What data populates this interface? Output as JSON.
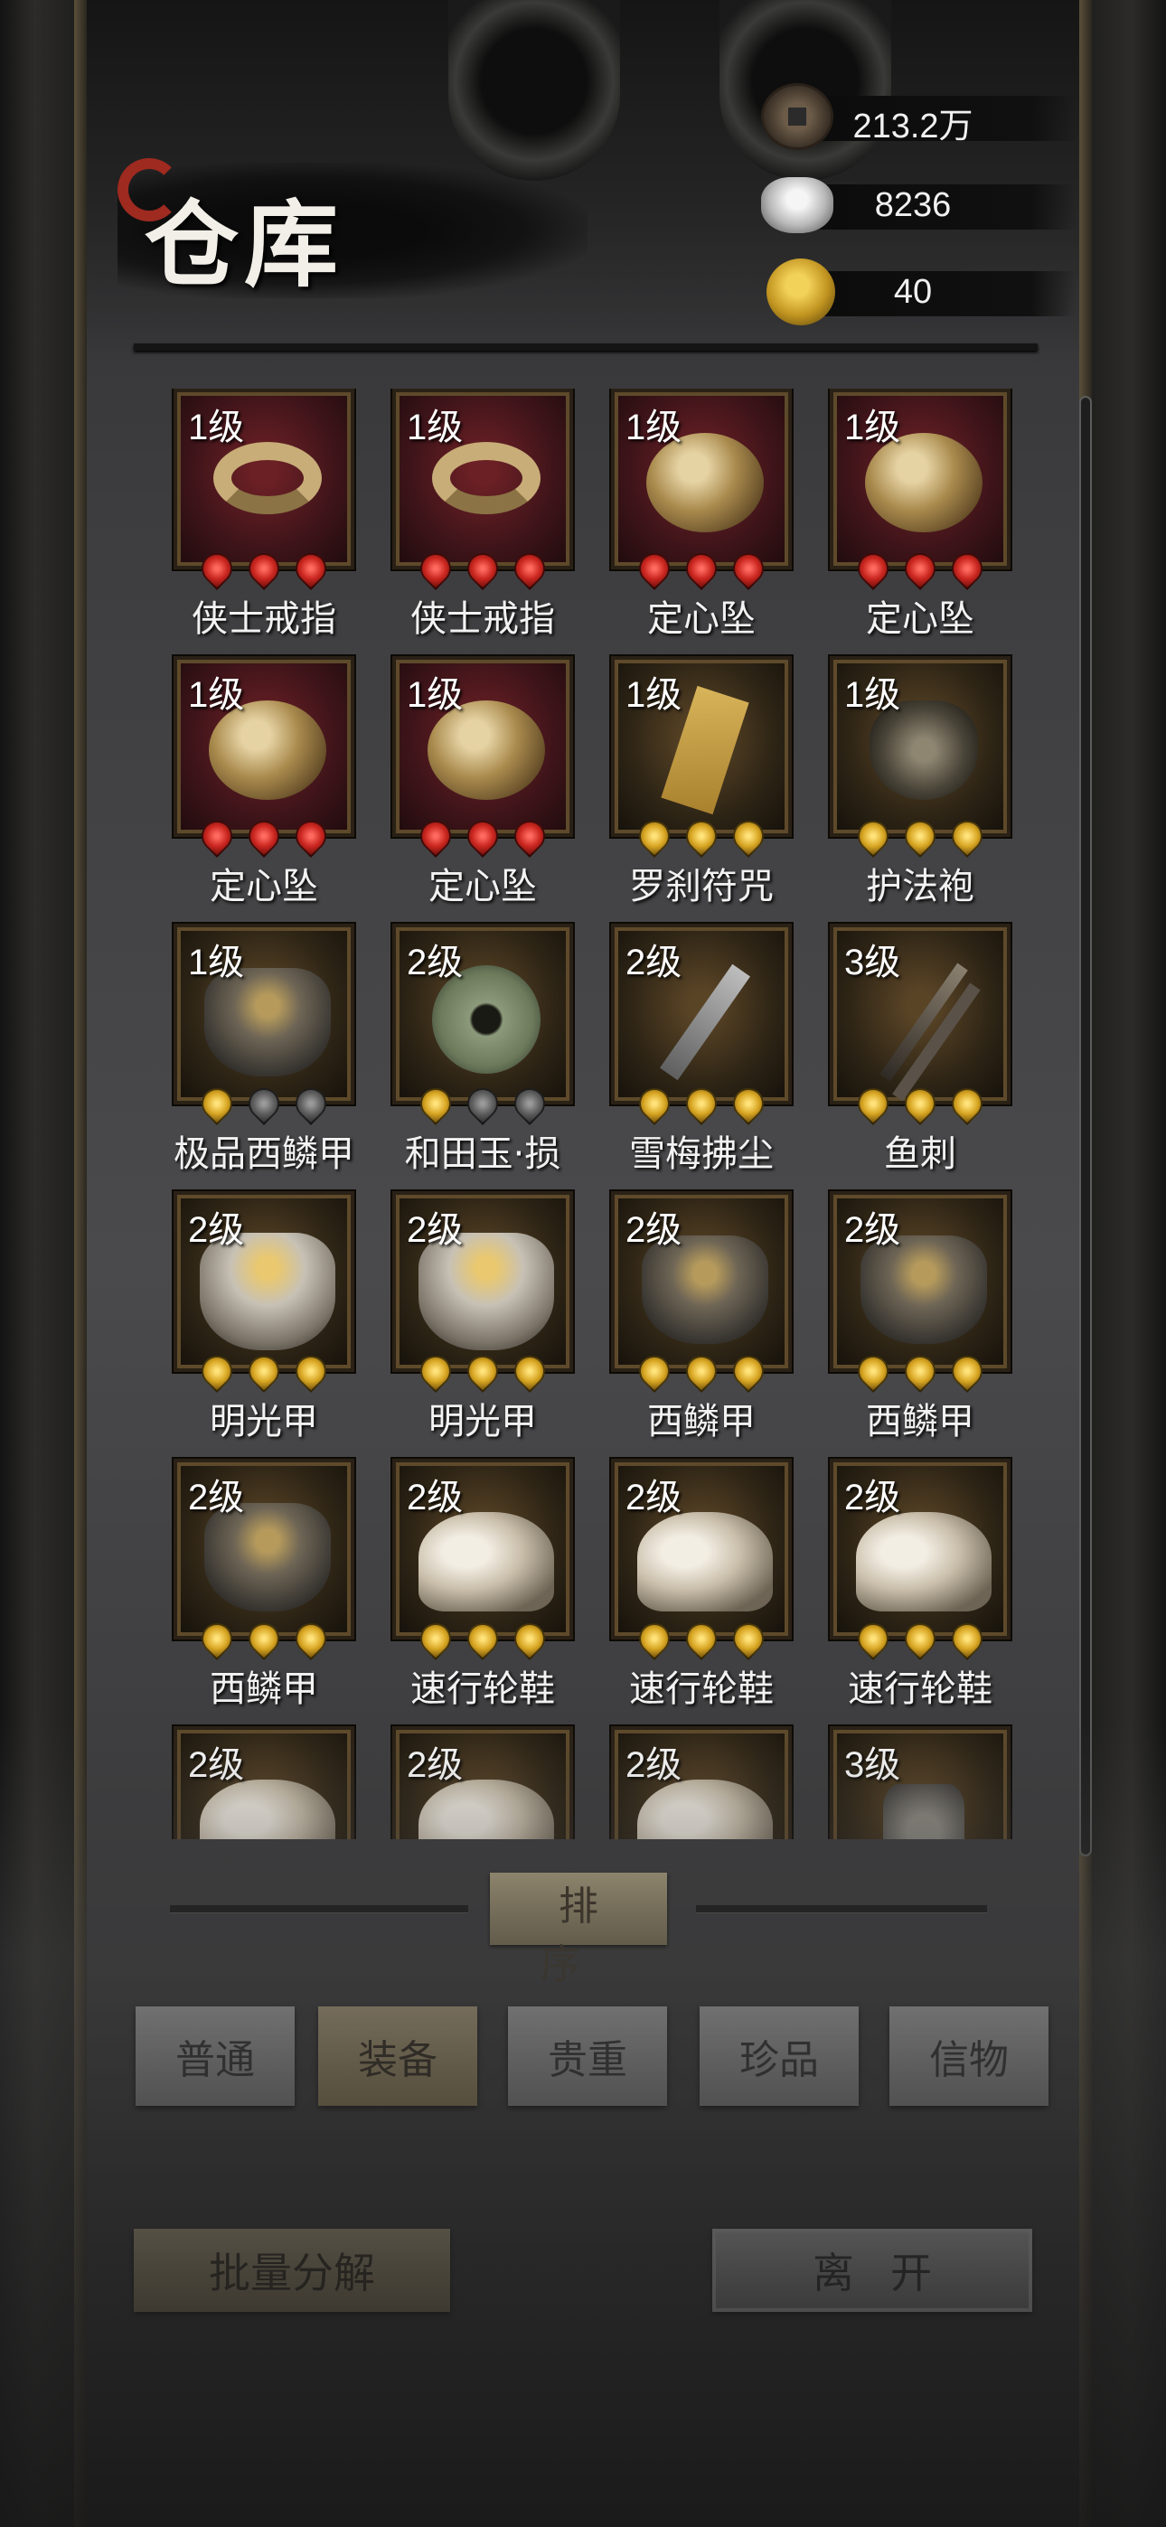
{
  "header": {
    "title": "仓库"
  },
  "currency": [
    {
      "icon": "copper-coin-icon",
      "value": "213.2万"
    },
    {
      "icon": "silver-ingot-icon",
      "value": "8236"
    },
    {
      "icon": "gold-coin-icon",
      "value": "40"
    }
  ],
  "items": [
    {
      "level": "1级",
      "name": "侠士戒指",
      "frame": "red",
      "icon": "ring-icon",
      "stars": [
        "r",
        "r",
        "r"
      ]
    },
    {
      "level": "1级",
      "name": "侠士戒指",
      "frame": "red",
      "icon": "ring-icon",
      "stars": [
        "r",
        "r",
        "r"
      ]
    },
    {
      "level": "1级",
      "name": "定心坠",
      "frame": "red",
      "icon": "pendant-icon",
      "stars": [
        "r",
        "r",
        "r"
      ]
    },
    {
      "level": "1级",
      "name": "定心坠",
      "frame": "red",
      "icon": "pendant-icon",
      "stars": [
        "r",
        "r",
        "r"
      ]
    },
    {
      "level": "1级",
      "name": "定心坠",
      "frame": "red",
      "icon": "pendant-icon",
      "stars": [
        "r",
        "r",
        "r"
      ]
    },
    {
      "level": "1级",
      "name": "定心坠",
      "frame": "red",
      "icon": "pendant-icon",
      "stars": [
        "r",
        "r",
        "r"
      ]
    },
    {
      "level": "1级",
      "name": "罗刹符咒",
      "frame": "gold",
      "icon": "talisman-icon",
      "stars": [
        "g",
        "g",
        "g"
      ]
    },
    {
      "level": "1级",
      "name": "护法袍",
      "frame": "gold",
      "icon": "mask-icon",
      "stars": [
        "g",
        "g",
        "g"
      ]
    },
    {
      "level": "1级",
      "name": "极品西鳞甲",
      "frame": "gold",
      "icon": "armor-icon",
      "stars": [
        "g",
        "s",
        "s"
      ]
    },
    {
      "level": "2级",
      "name": "和田玉·损",
      "frame": "gold",
      "icon": "jade-disc-icon",
      "stars": [
        "g",
        "s",
        "s"
      ]
    },
    {
      "level": "2级",
      "name": "雪梅拂尘",
      "frame": "gold",
      "icon": "duster-icon",
      "stars": [
        "g",
        "g",
        "g"
      ]
    },
    {
      "level": "3级",
      "name": "鱼刺",
      "frame": "gold",
      "icon": "daggers-icon",
      "stars": [
        "g",
        "g",
        "g"
      ]
    },
    {
      "level": "2级",
      "name": "明光甲",
      "frame": "gold",
      "icon": "bright-armor-icon",
      "stars": [
        "g",
        "g",
        "g"
      ]
    },
    {
      "level": "2级",
      "name": "明光甲",
      "frame": "gold",
      "icon": "bright-armor-icon",
      "stars": [
        "g",
        "g",
        "g"
      ]
    },
    {
      "level": "2级",
      "name": "西鳞甲",
      "frame": "gold",
      "icon": "armor-icon",
      "stars": [
        "g",
        "g",
        "g"
      ]
    },
    {
      "level": "2级",
      "name": "西鳞甲",
      "frame": "gold",
      "icon": "armor-icon",
      "stars": [
        "g",
        "g",
        "g"
      ]
    },
    {
      "level": "2级",
      "name": "西鳞甲",
      "frame": "gold",
      "icon": "armor-icon",
      "stars": [
        "g",
        "g",
        "g"
      ]
    },
    {
      "level": "2级",
      "name": "速行轮鞋",
      "frame": "gold",
      "icon": "boots-icon",
      "stars": [
        "g",
        "g",
        "g"
      ]
    },
    {
      "level": "2级",
      "name": "速行轮鞋",
      "frame": "gold",
      "icon": "boots-icon",
      "stars": [
        "g",
        "g",
        "g"
      ]
    },
    {
      "level": "2级",
      "name": "速行轮鞋",
      "frame": "gold",
      "icon": "boots-icon",
      "stars": [
        "g",
        "g",
        "g"
      ]
    },
    {
      "level": "2级",
      "name": "",
      "frame": "gold",
      "icon": "boots-icon",
      "stars": []
    },
    {
      "level": "2级",
      "name": "",
      "frame": "gold",
      "icon": "boots-icon",
      "stars": []
    },
    {
      "level": "2级",
      "name": "",
      "frame": "gold",
      "icon": "boots-icon",
      "stars": []
    },
    {
      "level": "3级",
      "name": "",
      "frame": "gold",
      "icon": "tag-icon",
      "stars": []
    }
  ],
  "sort": {
    "label": "排序"
  },
  "tabs": [
    {
      "label": "普通",
      "active": false
    },
    {
      "label": "装备",
      "active": true
    },
    {
      "label": "贵重",
      "active": false
    },
    {
      "label": "珍品",
      "active": false
    },
    {
      "label": "信物",
      "active": false
    }
  ],
  "actions": {
    "bulk_label": "批量分解",
    "leave_label": "离开"
  }
}
